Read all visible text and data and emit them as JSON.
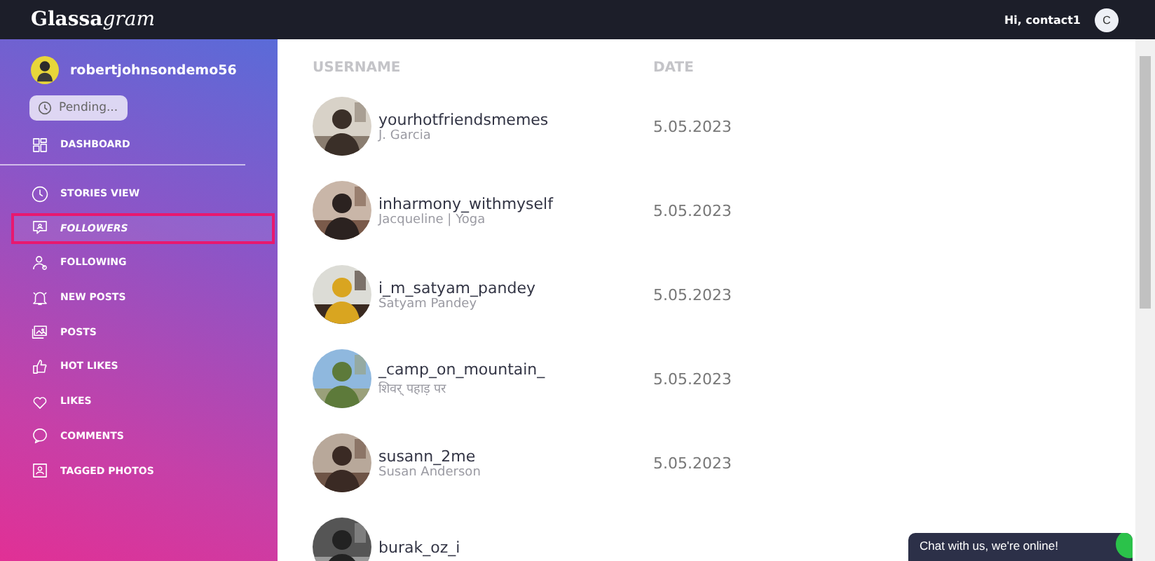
{
  "topbar": {
    "logo_regular": "Glassa",
    "logo_italic": "gram",
    "greeting": "Hi,  contact1",
    "avatar_letter": "C"
  },
  "sidebar": {
    "username": "robertjohnsondemo56",
    "status_button": "Pending...",
    "items": [
      {
        "label": "DASHBOARD",
        "selected": false
      },
      {
        "label": "STORIES VIEW",
        "selected": false
      },
      {
        "label": "FOLLOWERS",
        "selected": true
      },
      {
        "label": "FOLLOWING",
        "selected": false
      },
      {
        "label": "NEW POSTS",
        "selected": false
      },
      {
        "label": "POSTS",
        "selected": false
      },
      {
        "label": "HOT LIKES",
        "selected": false
      },
      {
        "label": "LIKES",
        "selected": false
      },
      {
        "label": "COMMENTS",
        "selected": false
      },
      {
        "label": "TAGGED PHOTOS",
        "selected": false
      }
    ]
  },
  "table": {
    "columns": [
      "USERNAME",
      "DATE"
    ],
    "rows": [
      {
        "username": "yourhotfriendsmemes",
        "name": "J. Garcia",
        "date": "5.05.2023"
      },
      {
        "username": "inharmony_withmyself",
        "name": "Jacqueline | Yoga",
        "date": "5.05.2023"
      },
      {
        "username": "i_m_satyam_pandey",
        "name": "Satyam Pandey",
        "date": "5.05.2023"
      },
      {
        "username": "_camp_on_mountain_",
        "name": "शिवर् पहाड़ पर",
        "date": "5.05.2023"
      },
      {
        "username": "susann_2me",
        "name": "Susan Anderson",
        "date": "5.05.2023"
      },
      {
        "username": "burak_oz_i",
        "date": ""
      }
    ]
  },
  "chat": {
    "text": "Chat with us, we're online!"
  }
}
